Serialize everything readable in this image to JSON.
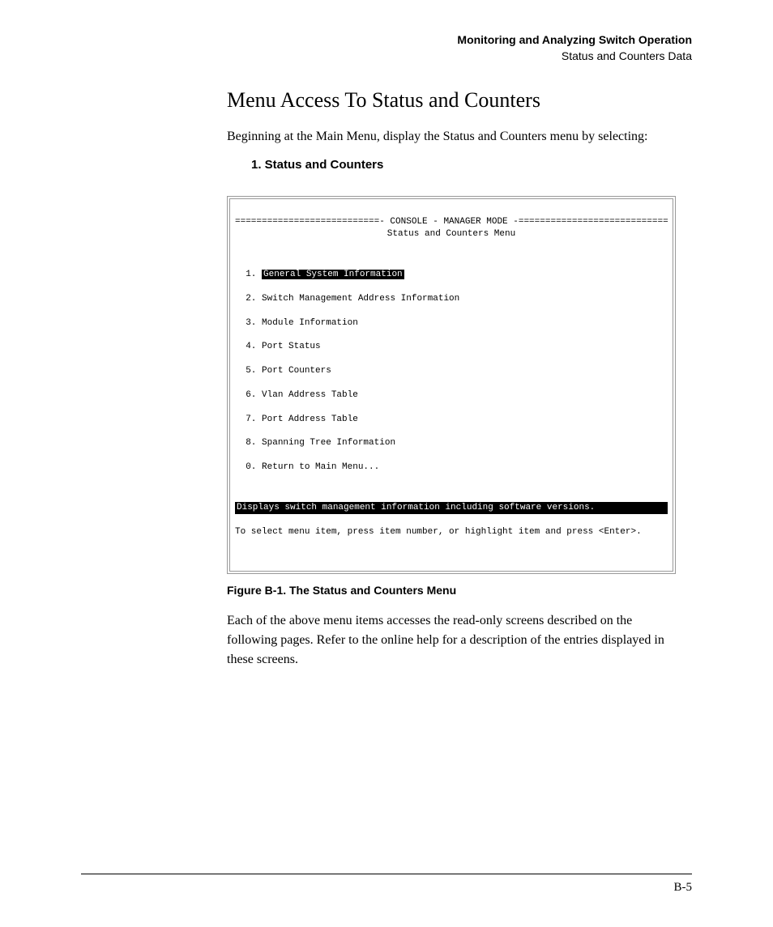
{
  "header": {
    "line1": "Monitoring and Analyzing Switch Operation",
    "line2": "Status and Counters Data"
  },
  "section_title": "Menu Access To Status and Counters",
  "intro": "Beginning at the Main Menu, display the Status and Counters menu by selecting:",
  "step": "1. Status and Counters",
  "console": {
    "header": "===========================- CONSOLE - MANAGER MODE -============================",
    "title": "Status and Counters Menu",
    "items": [
      {
        "num": "1.",
        "label": "General System Information",
        "selected": true
      },
      {
        "num": "2.",
        "label": "Switch Management Address Information",
        "selected": false
      },
      {
        "num": "3.",
        "label": "Module Information",
        "selected": false
      },
      {
        "num": "4.",
        "label": "Port Status",
        "selected": false
      },
      {
        "num": "5.",
        "label": "Port Counters",
        "selected": false
      },
      {
        "num": "6.",
        "label": "Vlan Address Table",
        "selected": false
      },
      {
        "num": "7.",
        "label": "Port Address Table",
        "selected": false
      },
      {
        "num": "8.",
        "label": "Spanning Tree Information",
        "selected": false
      },
      {
        "num": "0.",
        "label": "Return to Main Menu...",
        "selected": false
      }
    ],
    "status": "Displays switch management information including software versions.",
    "help": "To select menu item, press item number, or highlight item and press <Enter>."
  },
  "figure_caption": "Figure B-1.  The Status and Counters Menu",
  "body": "Each of the above menu items accesses the read-only screens described on the following pages. Refer to the online help for a description of the entries displayed in these screens.",
  "footer": "B-5"
}
